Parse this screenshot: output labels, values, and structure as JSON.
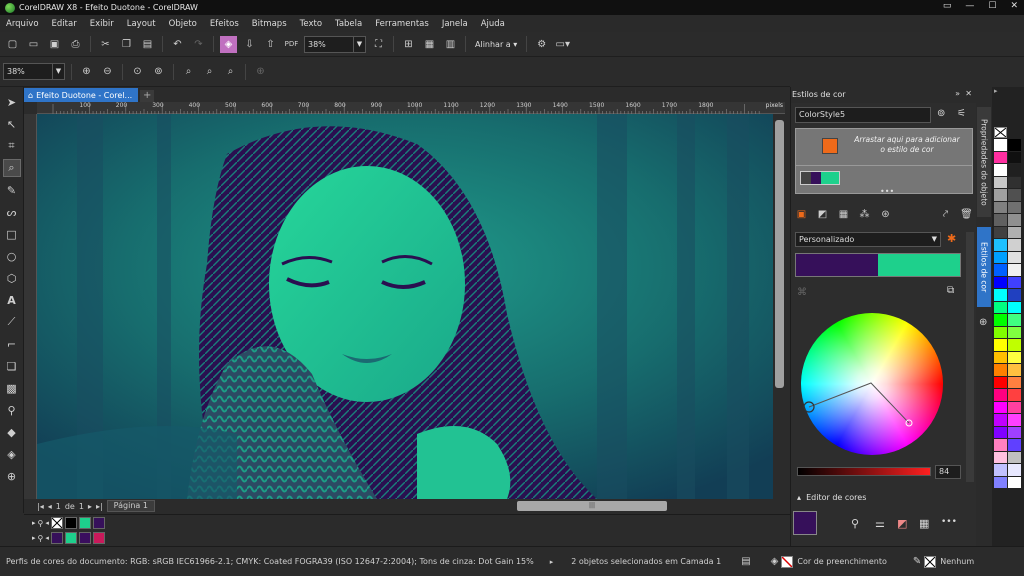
{
  "window": {
    "title": "CorelDRAW X8 - Efeito Duotone - CorelDRAW",
    "controls": [
      "▭",
      "—",
      "☐",
      "✕"
    ]
  },
  "menu": [
    "Arquivo",
    "Editar",
    "Exibir",
    "Layout",
    "Objeto",
    "Efeitos",
    "Bitmaps",
    "Texto",
    "Tabela",
    "Ferramentas",
    "Janela",
    "Ajuda"
  ],
  "toolbar": {
    "zoom": "38%",
    "align_label": "Alinhar a"
  },
  "propbar": {
    "zoom": "38%"
  },
  "doc_tab": {
    "label": "Efeito Duotone - Corel..."
  },
  "ruler": {
    "unit": "pixels",
    "ticks": [
      "100",
      "200",
      "300",
      "400",
      "500",
      "600",
      "700",
      "800",
      "900",
      "1000",
      "1100",
      "1200",
      "1300",
      "1400",
      "1500",
      "1600",
      "1700",
      "1800"
    ]
  },
  "pagenav": {
    "current": "1",
    "of": "de",
    "total": "1",
    "page_tab": "Página 1"
  },
  "palette_colors": [
    "#ffffff",
    "#000000",
    "#1ed08c",
    "#3a0e5e",
    "#c91a5b"
  ],
  "docker": {
    "title": "Estilos de cor",
    "style_name": "ColorStyle5",
    "dropzone_text": "Arrastar aqui para adicionar o estilo de cor",
    "harmony_select": "Personalizado",
    "gradient": {
      "from": "#36105a",
      "to": "#1ed08c"
    },
    "slider_value": "84",
    "color_editor_label": "Editor de cores",
    "editor_swatch": "#36105a"
  },
  "side_tabs": [
    "Propriedades do objeto",
    "Estilos de cor"
  ],
  "color_palette": {
    "col1": [
      "#ffffff",
      "#ff2fa0",
      "#ffffff",
      "#c8c8c8",
      "#a0a0a0",
      "#808080",
      "#606060",
      "#404040",
      "#1ec0ff",
      "#00a0ff",
      "#0060ff",
      "#0000ff",
      "#00ffff",
      "#00ff80",
      "#00ff00",
      "#80ff00",
      "#ffff00",
      "#ffc000",
      "#ff8000",
      "#ff0000",
      "#ff0080",
      "#ff00ff",
      "#c000ff",
      "#8000ff",
      "#ff80c0",
      "#ffc0e0",
      "#c0c0ff",
      "#8080ff"
    ],
    "col2": [
      "#000000",
      "#101010",
      "#202020",
      "#303030",
      "#505050",
      "#707070",
      "#909090",
      "#b0b0b0",
      "#d0d0d0",
      "#e0e0e0",
      "#f0f0f0",
      "#4040ff",
      "#2040c0",
      "#00ffff",
      "#40ff80",
      "#80ff40",
      "#c0ff00",
      "#ffff40",
      "#ffc040",
      "#ff8040",
      "#ff4040",
      "#ff40a0",
      "#ff40ff",
      "#a040ff",
      "#6040ff",
      "#c0c0c0",
      "#e8e8ff",
      "#ffffff"
    ]
  },
  "status": {
    "profiles": "Perfis de cores do documento: RGB: sRGB IEC61966-2.1; CMYK: Coated FOGRA39 (ISO 12647-2:2004); Tons de cinza: Dot Gain 15%",
    "selection": "2 objetos selecionados em Camada 1",
    "fill_label": "Cor de preenchimento",
    "outline_label": "Nenhum"
  }
}
